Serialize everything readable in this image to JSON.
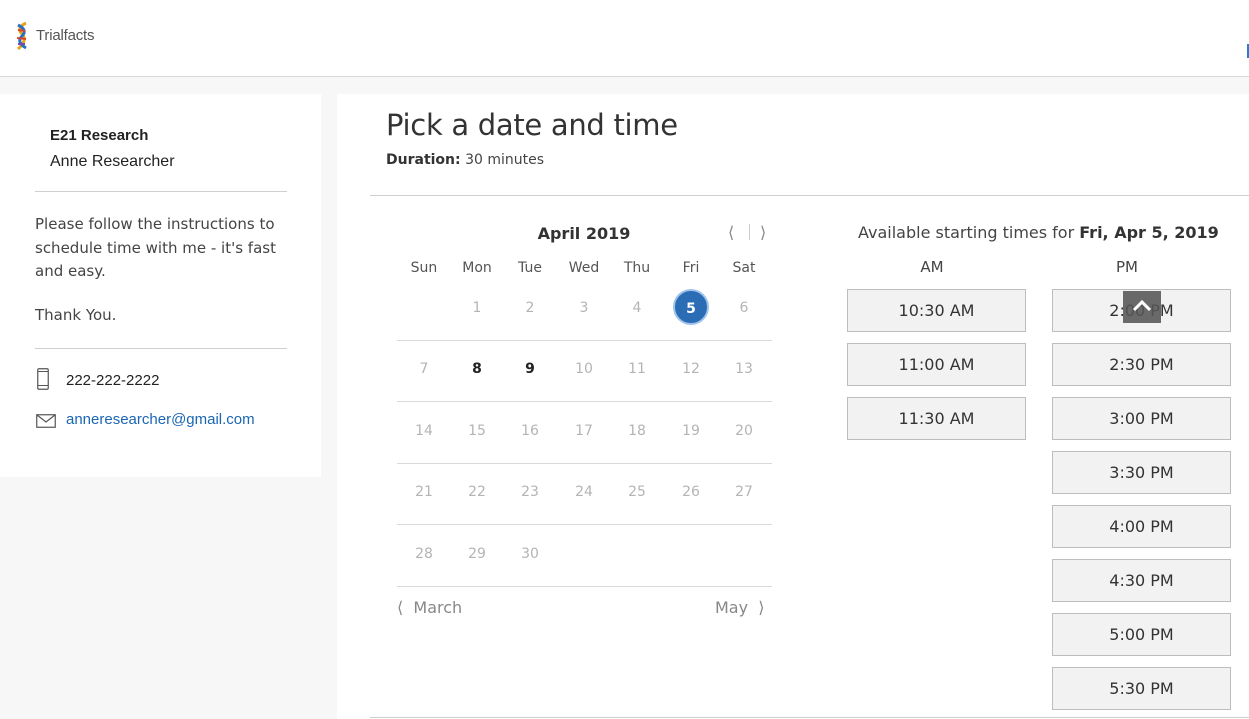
{
  "header": {
    "brand": "Trialfacts",
    "logo_icon": "dna-helix-logo"
  },
  "profile": {
    "organization": "E21 Research",
    "name": "Anne Researcher",
    "instructions": "Please follow the instructions to schedule time with me - it's fast and easy.",
    "thanks": "Thank You.",
    "phone": "222-222-2222",
    "email": "anneresearcher@gmail.com",
    "phone_icon": "phone-icon",
    "email_icon": "envelope-icon"
  },
  "page": {
    "title": "Pick a date and time",
    "duration_label": "Duration:",
    "duration_value": " 30 minutes"
  },
  "calendar": {
    "month_label": "April 2019",
    "prev_icon": "chevron-left-icon",
    "next_icon": "chevron-right-icon",
    "weekdays": [
      "Sun",
      "Mon",
      "Tue",
      "Wed",
      "Thu",
      "Fri",
      "Sat"
    ],
    "weeks": [
      [
        "",
        "1",
        "2",
        "3",
        "4",
        "5",
        "6"
      ],
      [
        "7",
        "8",
        "9",
        "10",
        "11",
        "12",
        "13"
      ],
      [
        "14",
        "15",
        "16",
        "17",
        "18",
        "19",
        "20"
      ],
      [
        "21",
        "22",
        "23",
        "24",
        "25",
        "26",
        "27"
      ],
      [
        "28",
        "29",
        "30",
        "",
        "",
        "",
        ""
      ]
    ],
    "available_days": [
      "8",
      "9"
    ],
    "selected_day": "5",
    "prev_month": "March",
    "next_month": "May",
    "accent_color": "#2a6db5"
  },
  "times": {
    "header_prefix": "Available starting times for ",
    "header_date": "Fri, Apr 5, 2019",
    "am_label": "AM",
    "pm_label": "PM",
    "am_slots": [
      "10:30 AM",
      "11:00 AM",
      "11:30 AM"
    ],
    "pm_slots": [
      "2:00 PM",
      "2:30 PM",
      "3:00 PM",
      "3:30 PM",
      "4:00 PM",
      "4:30 PM",
      "5:00 PM",
      "5:30 PM"
    ],
    "scroll_top_icon": "chevron-up-icon"
  }
}
